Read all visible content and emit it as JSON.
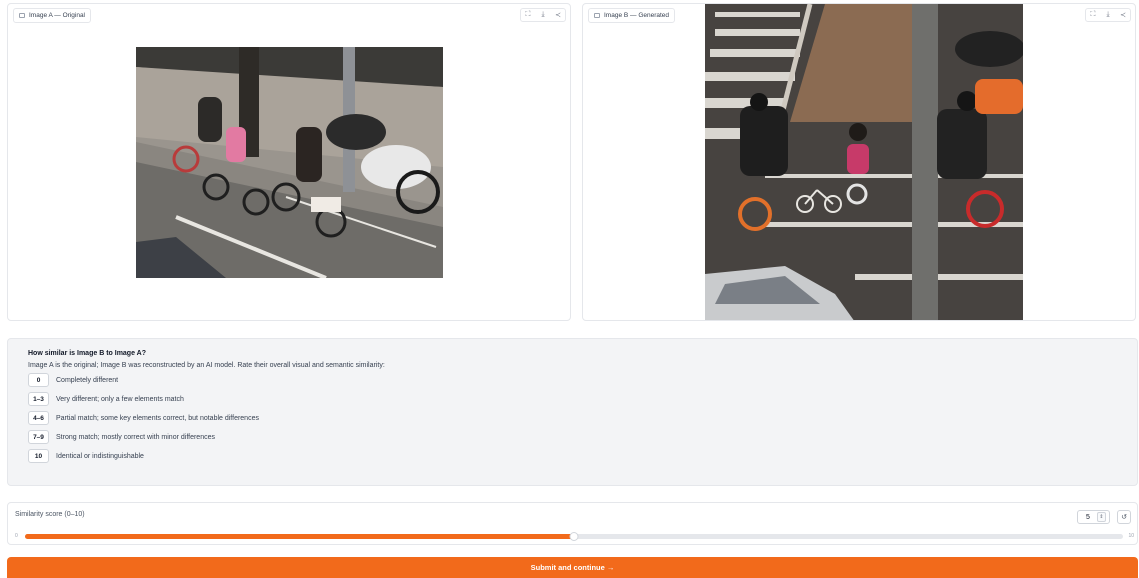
{
  "image_a": {
    "label": "Image A — Original",
    "tools": [
      "fullscreen-icon",
      "download-icon",
      "share-icon"
    ]
  },
  "image_b": {
    "label": "Image B — Generated",
    "tools": [
      "fullscreen-icon",
      "download-icon",
      "share-icon"
    ]
  },
  "rating": {
    "title": "How similar is Image B to Image A?",
    "description": "Image A is the original; Image B was reconstructed by an AI model. Rate their overall visual and semantic similarity:",
    "scale": [
      {
        "key": "0",
        "text": "Completely different"
      },
      {
        "key": "1–3",
        "text": "Very different; only a few elements match"
      },
      {
        "key": "4–6",
        "text": "Partial match; some key elements correct, but notable differences"
      },
      {
        "key": "7–9",
        "text": "Strong match; mostly correct with minor differences"
      },
      {
        "key": "10",
        "text": "Identical or indistinguishable"
      }
    ]
  },
  "score": {
    "label": "Similarity score (0–10)",
    "value": "5",
    "min_label": "0",
    "max_label": "10",
    "fraction": 0.5
  },
  "submit": {
    "label": "Submit and continue →"
  },
  "colors": {
    "accent": "#f26a1b"
  }
}
